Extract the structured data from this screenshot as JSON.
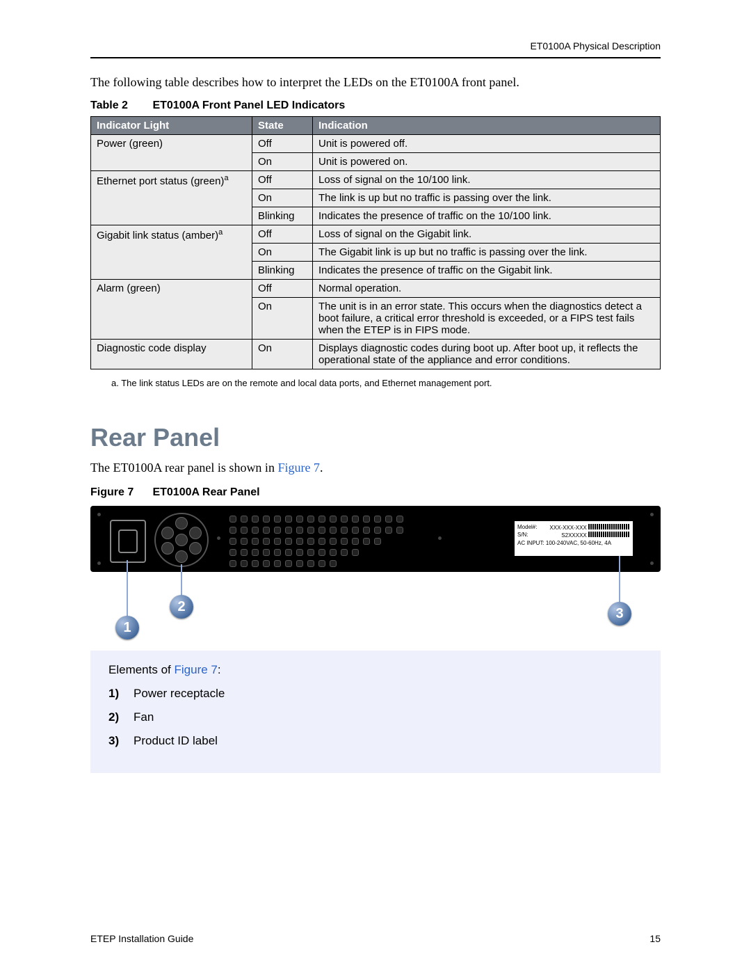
{
  "header": {
    "section": "ET0100A Physical Description"
  },
  "intro": "The following table describes how to interpret the LEDs on the ET0100A front panel.",
  "table2": {
    "label": "Table 2",
    "title": "ET0100A Front Panel LED Indicators",
    "headers": {
      "c1": "Indicator Light",
      "c2": "State",
      "c3": "Indication"
    },
    "rows": [
      {
        "light": "Power (green)",
        "span": 2,
        "state": "Off",
        "ind": "Unit is powered off."
      },
      {
        "state": "On",
        "ind": "Unit is powered on."
      },
      {
        "light_html": "Ethernet port status (green)",
        "sup": "a",
        "span": 3,
        "state": "Off",
        "ind": "Loss of signal on the 10/100 link."
      },
      {
        "state": "On",
        "ind": "The link is up but no traffic is passing over the link."
      },
      {
        "state": "Blinking",
        "ind": "Indicates the presence of traffic on the 10/100 link."
      },
      {
        "light_html": "Gigabit link status (amber)",
        "sup": "a",
        "span": 3,
        "state": "Off",
        "ind": "Loss of signal on the Gigabit link."
      },
      {
        "state": "On",
        "ind": "The Gigabit link is up but no traffic is passing over the link."
      },
      {
        "state": "Blinking",
        "ind": "Indicates the presence of traffic on the Gigabit link."
      },
      {
        "light": "Alarm (green)",
        "span": 2,
        "state": "Off",
        "ind": "Normal operation."
      },
      {
        "state": "On",
        "ind": "The unit is in an error state. This occurs when the diagnostics detect a boot failure, a critical error threshold is exceeded, or a FIPS test fails when the ETEP is in FIPS mode."
      },
      {
        "light": "Diagnostic code display",
        "span": 1,
        "state": "On",
        "ind": "Displays diagnostic codes during boot up. After boot up, it reflects the operational state of the appliance and error conditions."
      }
    ]
  },
  "footnote": {
    "marker": "a.",
    "text": "The link status LEDs are on the remote and local data ports, and Ethernet management port."
  },
  "section": {
    "heading": "Rear Panel"
  },
  "rear_intro": {
    "pre": "The ET0100A rear panel is shown in ",
    "link": "Figure 7",
    "post": "."
  },
  "figure7": {
    "label": "Figure 7",
    "title": "ET0100A Rear Panel"
  },
  "id_label": {
    "l1a": "Model#:",
    "l1b": "XXX-XXX-XXX",
    "l2a": "S/N:",
    "l2b": "S2XXXXX",
    "l3": "AC INPUT: 100-240VAC, 50-60Hz, 4A"
  },
  "callouts": {
    "c1": "1",
    "c2": "2",
    "c3": "3"
  },
  "elements": {
    "title_pre": "Elements of ",
    "title_link": "Figure 7",
    "title_post": ":",
    "items": [
      {
        "n": "1)",
        "t": "Power receptacle"
      },
      {
        "n": "2)",
        "t": "Fan"
      },
      {
        "n": "3)",
        "t": "Product ID label"
      }
    ]
  },
  "footer": {
    "left": "ETEP Installation Guide",
    "right": "15"
  }
}
